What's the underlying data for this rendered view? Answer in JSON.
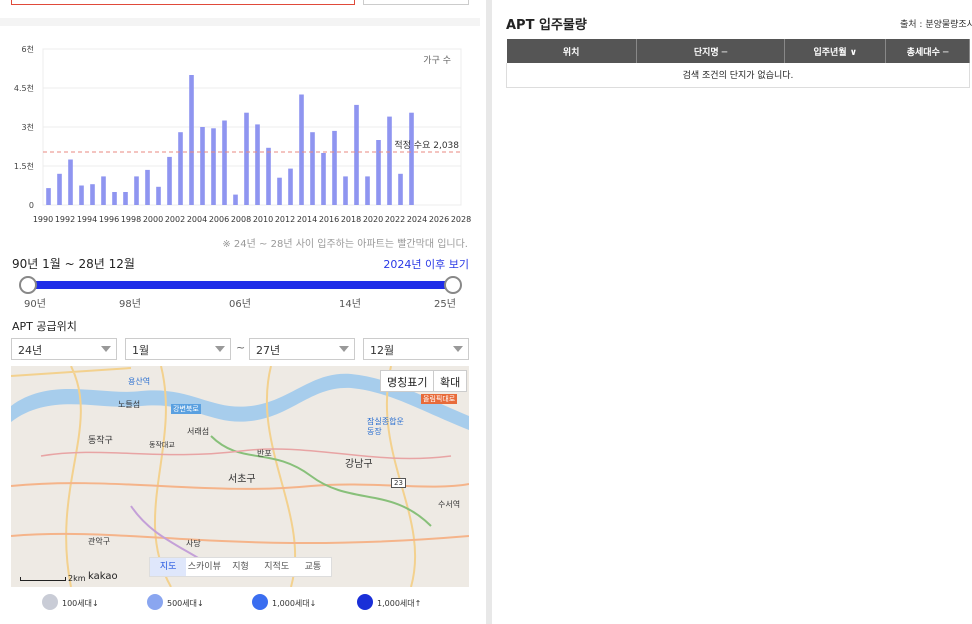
{
  "left": {
    "chart_legend": "가구 수",
    "demand_label": "적정 수요 2,038",
    "note": "※ 24년 ~ 28년 사이 입주하는 아파트는 빨간막대 입니다.",
    "period": "90년 1월 ~ 28년 12월",
    "after_link": "2024년 이후 보기",
    "slider_labels": [
      "90년",
      "98년",
      "06년",
      "14년",
      "25년"
    ],
    "supply_title": "APT 공급위치",
    "selects": {
      "start_year": "24년",
      "start_month": "1월",
      "end_year": "27년",
      "end_month": "12월"
    },
    "tilde": "~",
    "map": {
      "buttons": {
        "label_toggle": "명칭표기",
        "expand": "확대"
      },
      "types": [
        "지도",
        "스카이뷰",
        "지형",
        "지적도",
        "교통"
      ],
      "active_type": "지도",
      "scale": "2km",
      "brand": "kakao",
      "place_labels": [
        "동작구",
        "서초구",
        "강남구",
        "서래섬",
        "반포",
        "노들섬",
        "동작대교",
        "잠실종합운동장",
        "수서역",
        "사당",
        "관악구",
        "용산역",
        "강변북로",
        "올림픽대로",
        "23"
      ]
    },
    "legend": [
      "100세대↓",
      "500세대↓",
      "1,000세대↓",
      "1,000세대↑"
    ],
    "legend_colors": [
      "#c9ccd6",
      "#8aa6f0",
      "#3b6ef0",
      "#1a2fd8"
    ]
  },
  "right": {
    "title": "APT 입주물량",
    "source": "출처 : 분양물량조사",
    "columns": [
      "위치",
      "단지명 ─",
      "입주년월 ∨",
      "총세대수 ─"
    ],
    "empty_message": "검색 조건의 단지가 없습니다."
  },
  "chart_data": {
    "type": "bar",
    "title": "",
    "xlabel": "",
    "ylabel": "",
    "legend": "가구 수",
    "x_tick_labels": [
      "1990",
      "1992",
      "1994",
      "1996",
      "1998",
      "2000",
      "2002",
      "2004",
      "2006",
      "2008",
      "2010",
      "2012",
      "2014",
      "2016",
      "2018",
      "2020",
      "2022",
      "2024",
      "2026",
      "2028"
    ],
    "y_tick_labels": [
      "0",
      "1.5천",
      "3천",
      "4.5천",
      "6천"
    ],
    "ylim": [
      0,
      6000
    ],
    "categories": [
      1990,
      1991,
      1992,
      1993,
      1994,
      1995,
      1996,
      1997,
      1998,
      1999,
      2000,
      2001,
      2002,
      2003,
      2004,
      2005,
      2006,
      2007,
      2008,
      2009,
      2010,
      2011,
      2012,
      2013,
      2014,
      2015,
      2016,
      2017,
      2018,
      2019,
      2020,
      2021,
      2022,
      2023
    ],
    "values": [
      650,
      1200,
      1750,
      750,
      800,
      1100,
      500,
      500,
      1100,
      1350,
      700,
      1850,
      2800,
      5000,
      3000,
      2950,
      3250,
      400,
      3550,
      3100,
      2200,
      1050,
      1400,
      4250,
      2800,
      2000,
      2850,
      1100,
      3850,
      1100,
      2500,
      3400,
      1200,
      3550
    ],
    "reference_line": {
      "label": "적정 수요 2,038",
      "value": 2038
    },
    "bar_color": "#8f95f0",
    "reference_color": "#e88a80",
    "grid": true
  }
}
